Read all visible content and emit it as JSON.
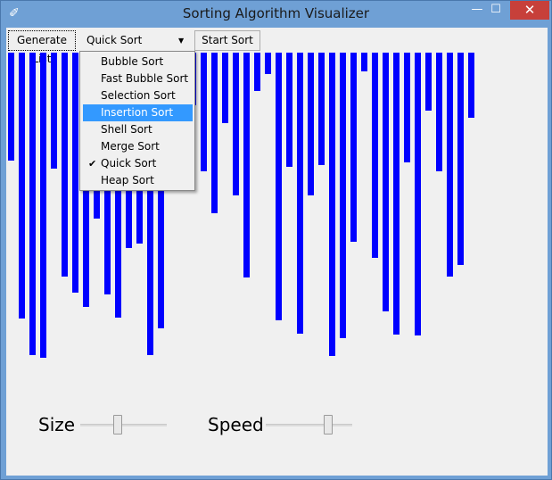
{
  "window": {
    "title": "Sorting Algorithm Visualizer",
    "icon": "feather-icon",
    "controls": {
      "minimize": "—",
      "maximize": "☐",
      "close": "✕"
    }
  },
  "toolbar": {
    "generate_label": "Generate List",
    "algorithm_selected": "Quick Sort",
    "start_label": "Start Sort"
  },
  "dropdown": {
    "items": [
      {
        "label": "Bubble Sort"
      },
      {
        "label": "Fast Bubble Sort"
      },
      {
        "label": "Selection Sort"
      },
      {
        "label": "Insertion Sort",
        "highlighted": true
      },
      {
        "label": "Shell Sort"
      },
      {
        "label": "Merge Sort"
      },
      {
        "label": "Quick Sort",
        "checked": true
      },
      {
        "label": "Heap Sort"
      }
    ],
    "check_glyph": "✔"
  },
  "bars": {
    "color": "#0000ff",
    "heights": [
      121,
      298,
      339,
      342,
      130,
      251,
      269,
      285,
      186,
      271,
      297,
      219,
      214,
      339,
      309,
      120,
      120,
      59,
      133,
      180,
      79,
      160,
      252,
      43,
      24,
      300,
      128,
      315,
      160,
      126,
      340,
      320,
      212,
      21,
      230,
      290,
      316,
      123,
      317,
      65,
      133,
      251,
      238,
      73
    ]
  },
  "controls": {
    "size_label": "Size",
    "speed_label": "Speed",
    "size_value": 0.42,
    "speed_value": 0.75
  }
}
